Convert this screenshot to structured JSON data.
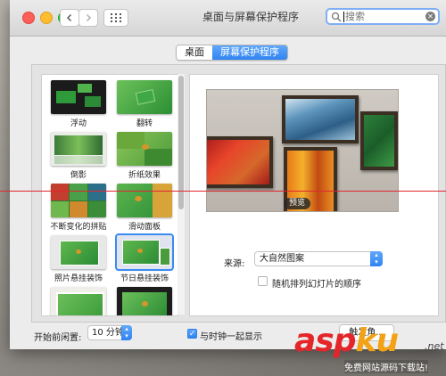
{
  "window": {
    "title": "桌面与屏幕保护程序"
  },
  "search": {
    "placeholder": "搜索"
  },
  "tabs": [
    {
      "label": "桌面",
      "active": false
    },
    {
      "label": "屏幕保护程序",
      "active": true
    }
  ],
  "savers": [
    {
      "label": "浮动",
      "selected": false
    },
    {
      "label": "翻转",
      "selected": false
    },
    {
      "label": "倒影",
      "selected": false
    },
    {
      "label": "折纸效果",
      "selected": false
    },
    {
      "label": "不断变化的拼贴",
      "selected": false
    },
    {
      "label": "滑动面板",
      "selected": false
    },
    {
      "label": "照片悬挂装饰",
      "selected": false
    },
    {
      "label": "节日悬挂装饰",
      "selected": true
    }
  ],
  "preview": {
    "label": "预览"
  },
  "source": {
    "label": "来源:",
    "value": "大自然图案"
  },
  "shuffle": {
    "label": "随机排列幻灯片的顺序",
    "checked": false
  },
  "idle": {
    "label": "开始前闲置:",
    "value": "10 分钟"
  },
  "clock": {
    "label": "与时钟一起显示",
    "checked": true
  },
  "hot_corners": {
    "label": "触发角..."
  },
  "watermark": {
    "brand_a": "asp",
    "brand_b": "ku",
    "tld": ".net",
    "tagline": "免费网站源码下载站!"
  },
  "colors": {
    "accent": "#2f84f1",
    "divider_line": "#e0262e",
    "watermark_red": "#e4262a",
    "watermark_orange": "#f3a215"
  }
}
